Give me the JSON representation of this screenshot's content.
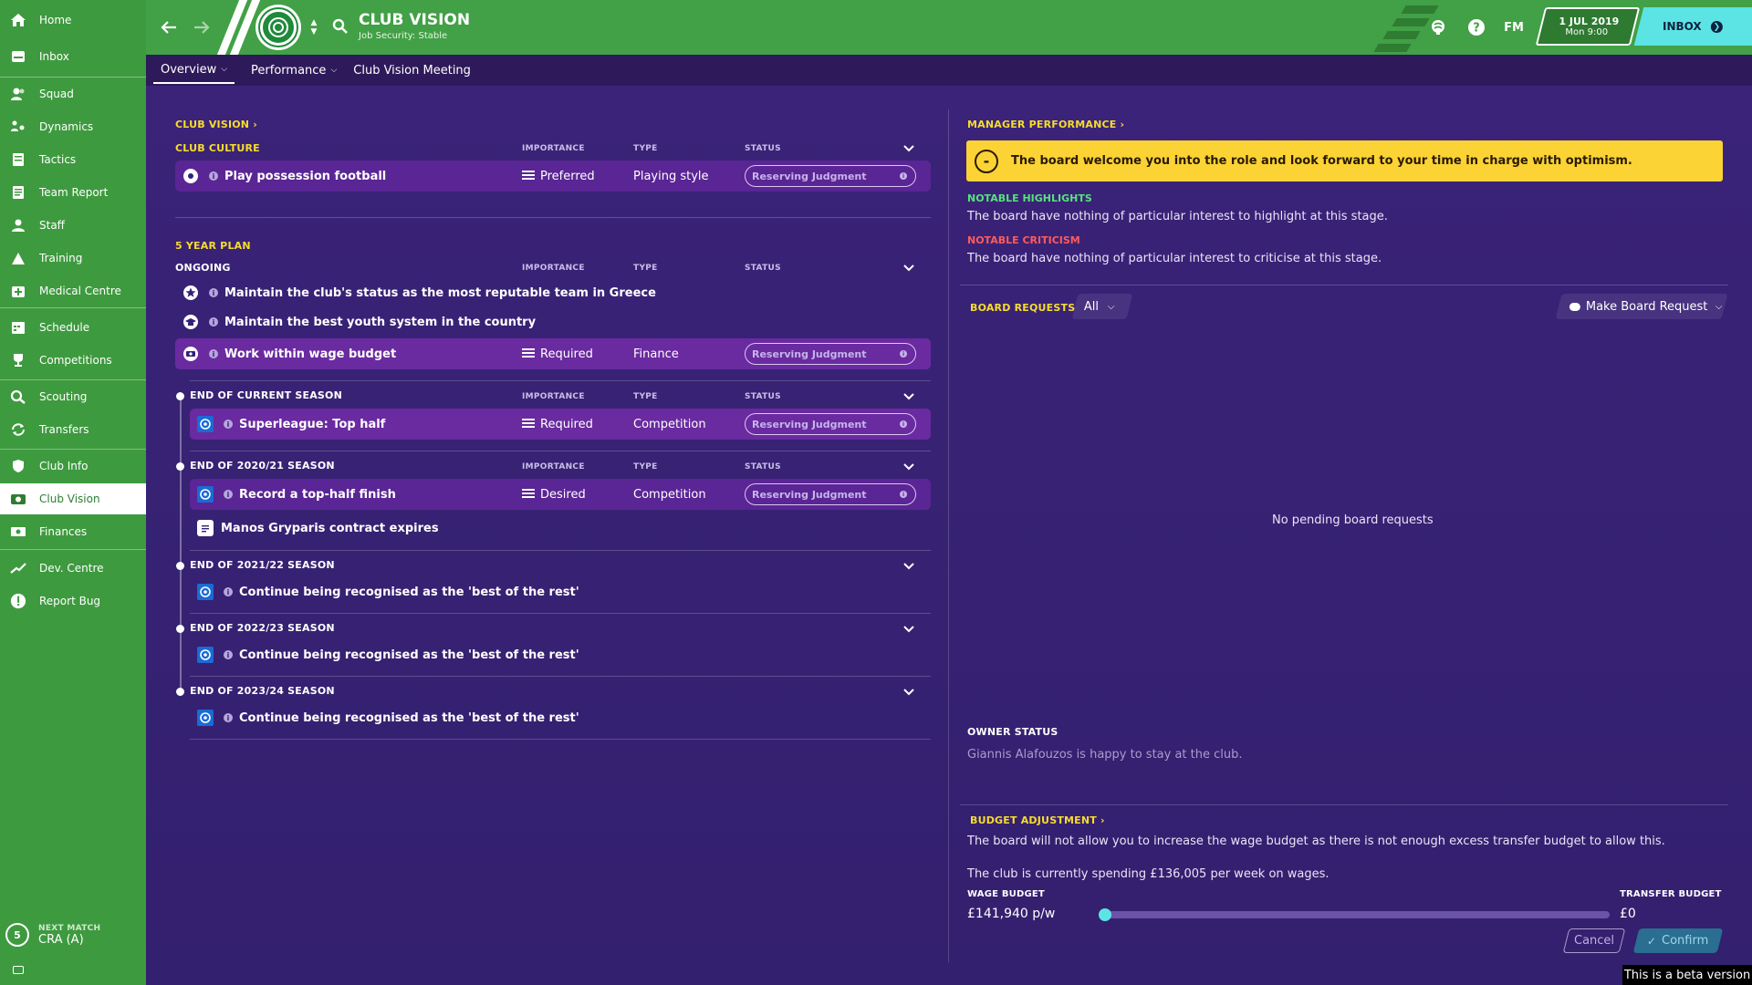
{
  "sidebar": {
    "items": [
      {
        "label": "Home",
        "icon": "home-icon"
      },
      {
        "label": "Inbox",
        "icon": "inbox-icon"
      },
      {
        "label": "Squad",
        "icon": "squad-icon"
      },
      {
        "label": "Dynamics",
        "icon": "dynamics-icon"
      },
      {
        "label": "Tactics",
        "icon": "tactics-icon"
      },
      {
        "label": "Team Report",
        "icon": "team-report-icon"
      },
      {
        "label": "Staff",
        "icon": "staff-icon"
      },
      {
        "label": "Training",
        "icon": "training-icon"
      },
      {
        "label": "Medical Centre",
        "icon": "medical-icon"
      },
      {
        "label": "Schedule",
        "icon": "schedule-icon"
      },
      {
        "label": "Competitions",
        "icon": "trophy-icon"
      },
      {
        "label": "Scouting",
        "icon": "scouting-icon"
      },
      {
        "label": "Transfers",
        "icon": "transfers-icon"
      },
      {
        "label": "Club Info",
        "icon": "shield-icon"
      },
      {
        "label": "Club Vision",
        "icon": "club-vision-icon"
      },
      {
        "label": "Finances",
        "icon": "finances-icon"
      },
      {
        "label": "Dev. Centre",
        "icon": "dev-centre-icon"
      },
      {
        "label": "Report Bug",
        "icon": "report-bug-icon"
      }
    ],
    "next_match": {
      "label": "NEXT MATCH",
      "value": "CRA (A)",
      "badge": "5"
    }
  },
  "header": {
    "title": "CLUB VISION",
    "subtitle": "Job Security: Stable",
    "date": "1 JUL 2019",
    "day_time": "Mon 9:00",
    "fm_label": "FM",
    "inbox_label": "INBOX"
  },
  "tabs": [
    {
      "label": "Overview"
    },
    {
      "label": "Performance"
    },
    {
      "label": "Club Vision Meeting"
    }
  ],
  "left": {
    "club_vision_link": "CLUB VISION",
    "club_culture": "CLUB CULTURE",
    "col_importance": "IMPORTANCE",
    "col_type": "TYPE",
    "col_status": "STATUS",
    "culture_row": {
      "text": "Play possession football",
      "importance": "Preferred",
      "type": "Playing style",
      "status": "Reserving Judgment"
    },
    "five_year_plan": "5 YEAR PLAN",
    "ongoing": "ONGOING",
    "ongoing_rows": [
      {
        "text": "Maintain the club's status as the most reputable team in Greece"
      },
      {
        "text": "Maintain the best youth system in the country"
      },
      {
        "text": "Work within wage budget",
        "importance": "Required",
        "type": "Finance",
        "status": "Reserving Judgment"
      }
    ],
    "sections": [
      {
        "title": "END OF CURRENT SEASON",
        "row": {
          "text": "Superleague: Top half",
          "importance": "Required",
          "type": "Competition",
          "status": "Reserving Judgment"
        }
      },
      {
        "title": "END OF 2020/21 SEASON",
        "row": {
          "text": "Record a top-half finish",
          "importance": "Desired",
          "type": "Competition",
          "status": "Reserving Judgment"
        },
        "extra": "Manos Gryparis contract expires"
      },
      {
        "title": "END OF 2021/22 SEASON",
        "row": {
          "text": "Continue being recognised as the 'best of the rest'"
        }
      },
      {
        "title": "END OF 2022/23 SEASON",
        "row": {
          "text": "Continue being recognised as the 'best of the rest'"
        }
      },
      {
        "title": "END OF 2023/24 SEASON",
        "row": {
          "text": "Continue being recognised as the 'best of the rest'"
        }
      }
    ]
  },
  "right": {
    "manager_performance": "MANAGER PERFORMANCE",
    "banner": "The board welcome you into the role and look forward to your time in charge with optimism.",
    "highlights_title": "NOTABLE HIGHLIGHTS",
    "highlights_text": "The board have nothing of particular interest to highlight at this stage.",
    "criticism_title": "NOTABLE CRITICISM",
    "criticism_text": "The board have nothing of particular interest to criticise at this stage.",
    "board_requests": "BOARD REQUESTS",
    "filter_value": "All",
    "make_request": "Make Board Request",
    "no_requests": "No pending board requests",
    "owner_status_title": "OWNER STATUS",
    "owner_status_text": "Giannis Alafouzos is happy to stay at the club.",
    "budget_adjustment": "BUDGET ADJUSTMENT",
    "budget_text1": "The board will not allow you to increase the wage budget as there is not enough excess transfer budget to allow this.",
    "budget_text2": "The club is currently spending £136,005 per week on wages.",
    "wage_budget_label": "WAGE BUDGET",
    "wage_budget_value": "£141,940 p/w",
    "transfer_budget_label": "TRANSFER BUDGET",
    "transfer_budget_value": "£0",
    "slider_position": 0,
    "cancel": "Cancel",
    "confirm": "Confirm"
  },
  "beta_notice": "This is a beta version",
  "colors": {
    "sidebar": "#3e9a3f",
    "header": "#42a046",
    "background": "#35207a",
    "accent_yellow": "#f7dc2c",
    "accent_cyan": "#5ce4e4",
    "highlight_green": "#55e37a",
    "criticism_red": "#ff5b5b"
  }
}
